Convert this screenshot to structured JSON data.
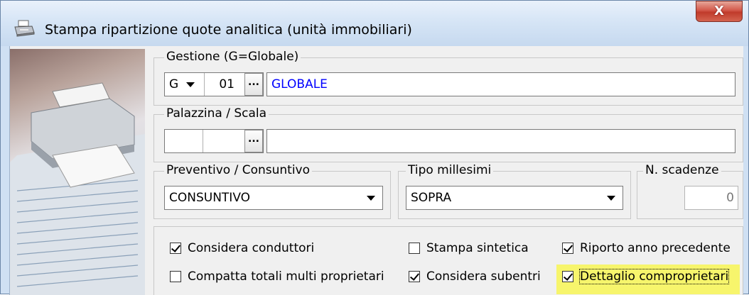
{
  "window": {
    "title": "Stampa ripartizione quote analitica (unità immobiliari)",
    "close_label": "X"
  },
  "gestione": {
    "legend": "Gestione (G=Globale)",
    "type": "G",
    "code": "01",
    "browse_label": "...",
    "description": "GLOBALE"
  },
  "palazzina": {
    "legend": "Palazzina / Scala",
    "palazzina": "",
    "scala": "",
    "browse_label": "...",
    "description": ""
  },
  "preventivo": {
    "legend": "Preventivo / Consuntivo",
    "value": "CONSUNTIVO"
  },
  "millesimi": {
    "legend": "Tipo millesimi",
    "value": "SOPRA"
  },
  "scadenze": {
    "legend": "N. scadenze",
    "value": "0"
  },
  "options": [
    {
      "label": "Considera conduttori",
      "checked": true
    },
    {
      "label": "Stampa sintetica",
      "checked": false
    },
    {
      "label": "Riporto anno precedente",
      "checked": true
    },
    {
      "label": "Compatta totali multi proprietari",
      "checked": false
    },
    {
      "label": "Considera subentri",
      "checked": true
    },
    {
      "label": "Dettaglio comproprietari",
      "checked": true
    }
  ],
  "colors": {
    "highlight": "#f7f56c",
    "accent_text": "#0000ff"
  }
}
